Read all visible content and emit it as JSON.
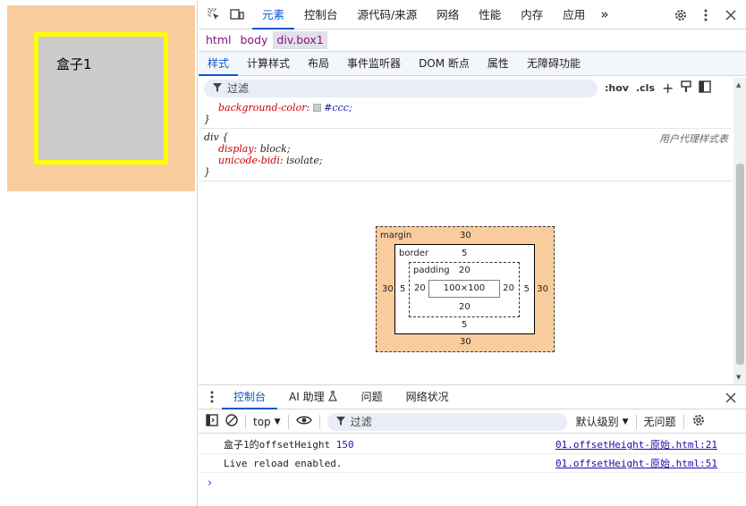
{
  "page": {
    "box_text": "盒子1",
    "colors": {
      "margin": "#f9cc9d",
      "box_bg": "#cccccc",
      "box_border": "#ffff00"
    }
  },
  "devtools": {
    "tabs": [
      "元素",
      "控制台",
      "源代码/来源",
      "网络",
      "性能",
      "内存",
      "应用"
    ],
    "active_tab": "元素",
    "more_tabs": "»",
    "breadcrumbs": [
      "html",
      "body",
      "div.box1"
    ],
    "subtabs": [
      "样式",
      "计算样式",
      "布局",
      "事件监听器",
      "DOM 断点",
      "属性",
      "无障碍功能"
    ],
    "filter_placeholder": "过滤",
    "hov": ":hov",
    "cls": ".cls",
    "rule1": {
      "prop": "background-color",
      "value": "#ccc;",
      "close": "}"
    },
    "rule2": {
      "selector": "div {",
      "ua_label": "用户代理样式表",
      "p1": "display",
      "v1": "block;",
      "p2": "unicode-bidi",
      "v2": "isolate;",
      "close": "}"
    },
    "box_model": {
      "margin_label": "margin",
      "border_label": "border",
      "padding_label": "padding",
      "margin": {
        "top": "30",
        "right": "30",
        "bottom": "30",
        "left": "30"
      },
      "border": {
        "top": "5",
        "right": "5",
        "bottom": "5",
        "left": "5"
      },
      "padding": {
        "top": "20",
        "right": "20",
        "bottom": "20",
        "left": "20"
      },
      "content": "100×100"
    }
  },
  "drawer": {
    "tabs": [
      "控制台",
      "AI 助理",
      "问题",
      "网络状况"
    ],
    "context": "top",
    "filter_placeholder": "过滤",
    "level": "默认级别",
    "issues": "无问题",
    "logs": [
      {
        "text": "盒子1的offsetHeight",
        "number": "150",
        "source": "01.offsetHeight-原始.html:21"
      },
      {
        "text": "Live reload enabled.",
        "number": "",
        "source": "01.offsetHeight-原始.html:51"
      }
    ],
    "prompt": "›"
  }
}
